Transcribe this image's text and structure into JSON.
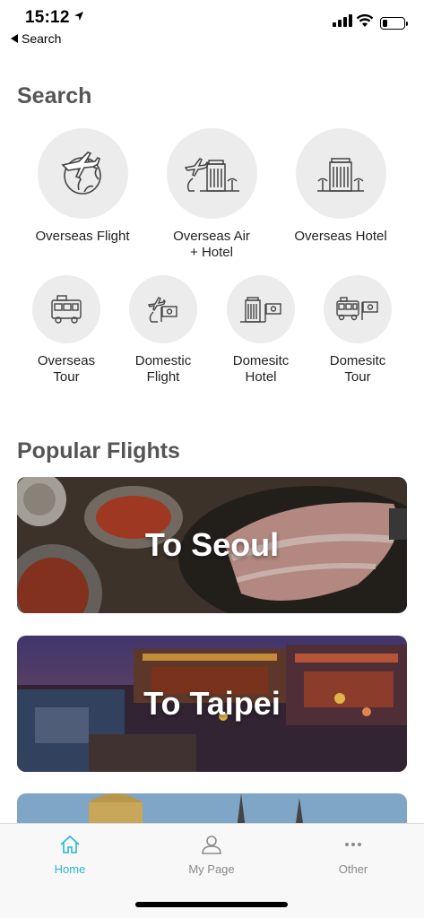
{
  "status_bar": {
    "time": "15:12",
    "back_label": "Search"
  },
  "search": {
    "title": "Search",
    "row1": [
      {
        "label": "Overseas Flight",
        "icon": "globe-plane-icon"
      },
      {
        "label": "Overseas Air\n+ Hotel",
        "icon": "plane-hotel-icon"
      },
      {
        "label": "Overseas Hotel",
        "icon": "hotel-icon"
      }
    ],
    "row2": [
      {
        "label": "Overseas\nTour",
        "icon": "tour-bus-icon"
      },
      {
        "label": "Domestic\nFlight",
        "icon": "domestic-plane-icon"
      },
      {
        "label": "Domesitc\nHotel",
        "icon": "domestic-hotel-icon"
      },
      {
        "label": "Domesitc\nTour",
        "icon": "domestic-tour-icon"
      }
    ]
  },
  "popular": {
    "title": "Popular Flights",
    "cards": [
      {
        "title": "To Seoul"
      },
      {
        "title": "To Taipei"
      }
    ]
  },
  "tab_bar": {
    "tabs": [
      {
        "label": "Home",
        "icon": "home-icon",
        "active": true
      },
      {
        "label": "My Page",
        "icon": "user-icon",
        "active": false
      },
      {
        "label": "Other",
        "icon": "more-icon",
        "active": false
      }
    ],
    "accent": "#29b6d1"
  }
}
